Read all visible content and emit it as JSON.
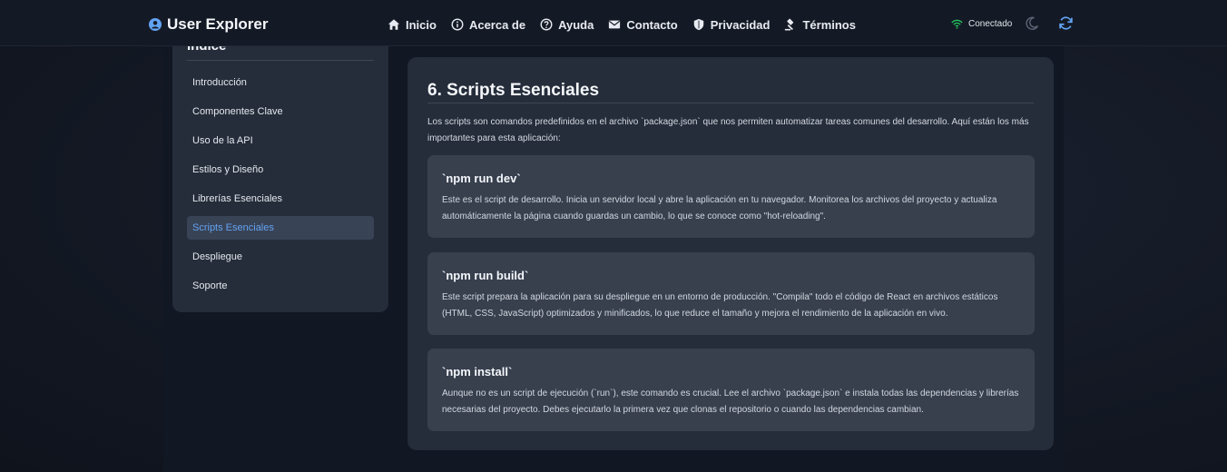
{
  "navbar": {
    "brand": "User Explorer",
    "links": [
      {
        "label": "Inicio",
        "icon": "home-icon"
      },
      {
        "label": "Acerca de",
        "icon": "info-icon"
      },
      {
        "label": "Ayuda",
        "icon": "help-icon"
      },
      {
        "label": "Contacto",
        "icon": "mail-icon"
      },
      {
        "label": "Privacidad",
        "icon": "shield-icon"
      },
      {
        "label": "Términos",
        "icon": "gavel-icon"
      }
    ],
    "status": "Conectado",
    "colors": {
      "accent": "#62a3f2",
      "status": "#22c55e"
    }
  },
  "sidebar": {
    "title": "Índice",
    "items": [
      {
        "label": "Introducción",
        "active": false
      },
      {
        "label": "Componentes Clave",
        "active": false
      },
      {
        "label": "Uso de la API",
        "active": false
      },
      {
        "label": "Estilos y Diseño",
        "active": false
      },
      {
        "label": "Librerías Esenciales",
        "active": false
      },
      {
        "label": "Scripts Esenciales",
        "active": true
      },
      {
        "label": "Despliegue",
        "active": false
      },
      {
        "label": "Soporte",
        "active": false
      }
    ]
  },
  "main": {
    "title": "6. Scripts Esenciales",
    "intro": "Los scripts son comandos predefinidos en el archivo `package.json` que nos permiten automatizar tareas comunes del desarrollo. Aquí están los más importantes para esta aplicación:",
    "scripts": [
      {
        "title": "`npm run dev`",
        "description": "Este es el script de desarrollo. Inicia un servidor local y abre la aplicación en tu navegador. Monitorea los archivos del proyecto y actualiza automáticamente la página cuando guardas un cambio, lo que se conoce como \"hot-reloading\"."
      },
      {
        "title": "`npm run build`",
        "description": "Este script prepara la aplicación para su despliegue en un entorno de producción. \"Compila\" todo el código de React en archivos estáticos (HTML, CSS, JavaScript) optimizados y minificados, lo que reduce el tamaño y mejora el rendimiento de la aplicación en vivo."
      },
      {
        "title": "`npm install`",
        "description": "Aunque no es un script de ejecución (`run`), este comando es crucial. Lee el archivo `package.json` e instala todas las dependencias y librerías necesarias del proyecto. Debes ejecutarlo la primera vez que clonas el repositorio o cuando las dependencias cambian."
      }
    ]
  }
}
